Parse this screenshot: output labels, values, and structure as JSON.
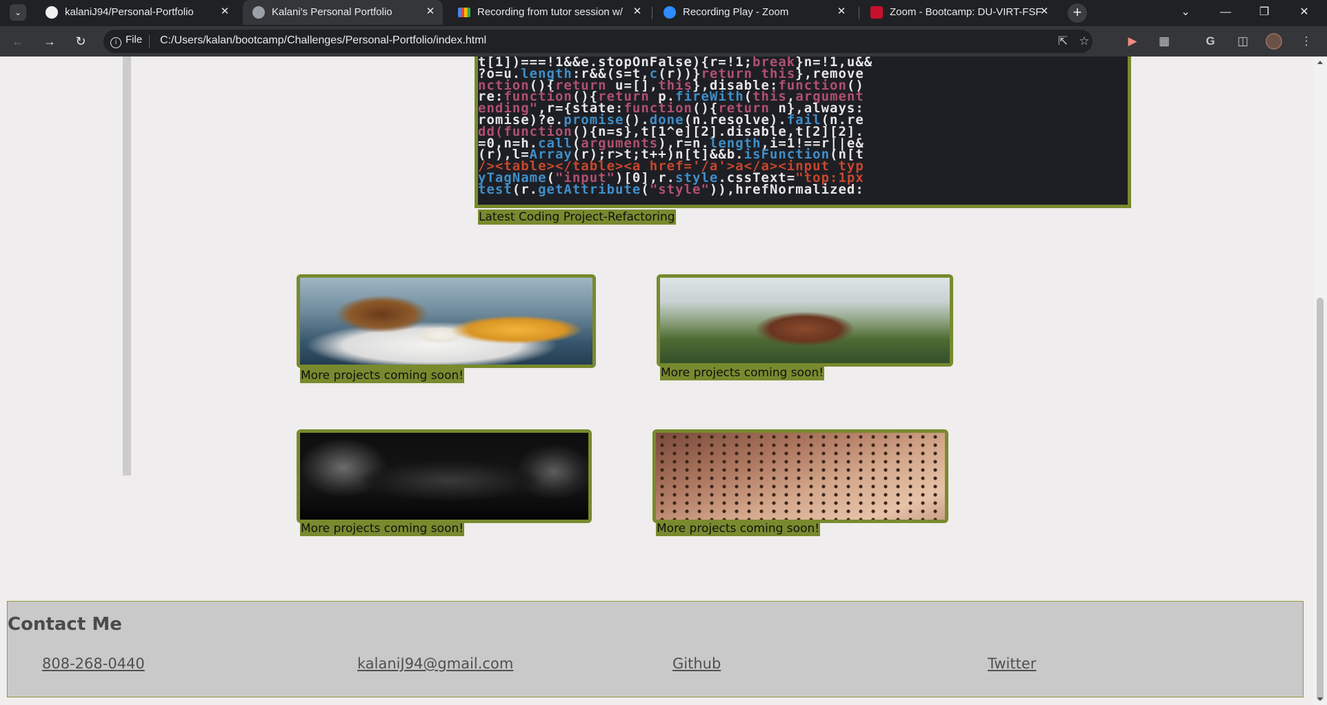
{
  "browser": {
    "tabs": [
      {
        "title": "kalaniJ94/Personal-Portfolio",
        "icon": "github-icon",
        "active": false
      },
      {
        "title": "Kalani's Personal Portfolio",
        "icon": "globe-icon",
        "active": true
      },
      {
        "title": "Recording from tutor session w/",
        "icon": "gmail-icon",
        "active": false
      },
      {
        "title": "Recording Play - Zoom",
        "icon": "zoom-icon",
        "active": false
      },
      {
        "title": "Zoom - Bootcamp: DU-VIRT-FSF",
        "icon": "shield-icon",
        "active": false
      }
    ],
    "address": {
      "scheme_label": "File",
      "url": "C:/Users/kalan/bootcamp/Challenges/Personal-Portfolio/index.html"
    }
  },
  "page": {
    "featured": {
      "caption": "Latest Coding Project-Refactoring",
      "code_lines": [
        [
          [
            "w",
            "t[1])===!1&&e.stopOnFalse){r=!1;"
          ],
          [
            "p",
            "break"
          ],
          [
            "w",
            "}n=!1,u&&"
          ]
        ],
        [
          [
            "w",
            "?o=u."
          ],
          [
            "b",
            "length"
          ],
          [
            "w",
            ":r&&(s=t,"
          ],
          [
            "b",
            "c"
          ],
          [
            "w",
            "(r))}"
          ],
          [
            "p",
            "return this"
          ],
          [
            "w",
            "},remove"
          ]
        ],
        [
          [
            "p",
            "nction"
          ],
          [
            "w",
            "(){"
          ],
          [
            "p",
            "return"
          ],
          [
            "w",
            " u=[],"
          ],
          [
            "p",
            "this"
          ],
          [
            "w",
            "},disable:"
          ],
          [
            "p",
            "function"
          ],
          [
            "w",
            "()"
          ]
        ],
        [
          [
            "w",
            "re:"
          ],
          [
            "p",
            "function"
          ],
          [
            "w",
            "(){"
          ],
          [
            "p",
            "return"
          ],
          [
            "w",
            " p."
          ],
          [
            "b",
            "fireWith"
          ],
          [
            "w",
            "("
          ],
          [
            "p",
            "this"
          ],
          [
            "w",
            ","
          ],
          [
            "p",
            "argument"
          ]
        ],
        [
          [
            "p",
            "ending\""
          ],
          [
            "w",
            ",r={state:"
          ],
          [
            "p",
            "function"
          ],
          [
            "w",
            "(){"
          ],
          [
            "p",
            "return"
          ],
          [
            "w",
            " n},always:"
          ]
        ],
        [
          [
            "w",
            "romise)?e."
          ],
          [
            "b",
            "promise"
          ],
          [
            "w",
            "()."
          ],
          [
            "b",
            "done"
          ],
          [
            "w",
            "(n.resolve)."
          ],
          [
            "b",
            "fail"
          ],
          [
            "w",
            "(n.re"
          ]
        ],
        [
          [
            "p",
            "dd(function"
          ],
          [
            "w",
            "(){n=s},t[1^e][2].disable,t[2][2]."
          ]
        ],
        [
          [
            "w",
            "=0,n=h."
          ],
          [
            "b",
            "call"
          ],
          [
            "w",
            "("
          ],
          [
            "p",
            "arguments"
          ],
          [
            "w",
            "),r=n."
          ],
          [
            "b",
            "length"
          ],
          [
            "w",
            ",i=1!==r||e&"
          ]
        ],
        [
          [
            "w",
            "(r),l="
          ],
          [
            "b",
            "Array"
          ],
          [
            "w",
            "(r);r>t;t++)n[t]&&b."
          ],
          [
            "b",
            "isFunction"
          ],
          [
            "w",
            "(n[t"
          ]
        ],
        [
          [
            "o",
            "/><table></table><a href='/a'>a</a><input typ"
          ]
        ],
        [
          [
            "b",
            "yTagName"
          ],
          [
            "w",
            "("
          ],
          [
            "p",
            "\"input\""
          ],
          [
            "w",
            ")[0],r."
          ],
          [
            "b",
            "style"
          ],
          [
            "w",
            ".cssText="
          ],
          [
            "o",
            "\"top:1px"
          ]
        ],
        [
          [
            "b",
            "test"
          ],
          [
            "w",
            "(r."
          ],
          [
            "b",
            "getAttribute"
          ],
          [
            "w",
            "("
          ],
          [
            "p",
            "\"style\""
          ],
          [
            "w",
            ")),hrefNormalized:"
          ]
        ]
      ]
    },
    "projects": [
      {
        "caption": "More projects coming soon!",
        "image": "burger-and-fries"
      },
      {
        "caption": "More projects coming soon!",
        "image": "football-on-field"
      },
      {
        "caption": "More projects coming soon!",
        "image": "game-controller"
      },
      {
        "caption": "More projects coming soon!",
        "image": "audio-mixer"
      }
    ],
    "footer": {
      "heading": "Contact Me",
      "links": [
        {
          "label": "808-268-0440"
        },
        {
          "label": "kalaniJ94@gmail.com"
        },
        {
          "label": "Github"
        },
        {
          "label": "Twitter"
        }
      ]
    }
  },
  "colors": {
    "accent_green": "#788a2e",
    "page_bg": "#efeded",
    "footer_bg": "#cac9ca",
    "browser_dark": "#202124"
  }
}
